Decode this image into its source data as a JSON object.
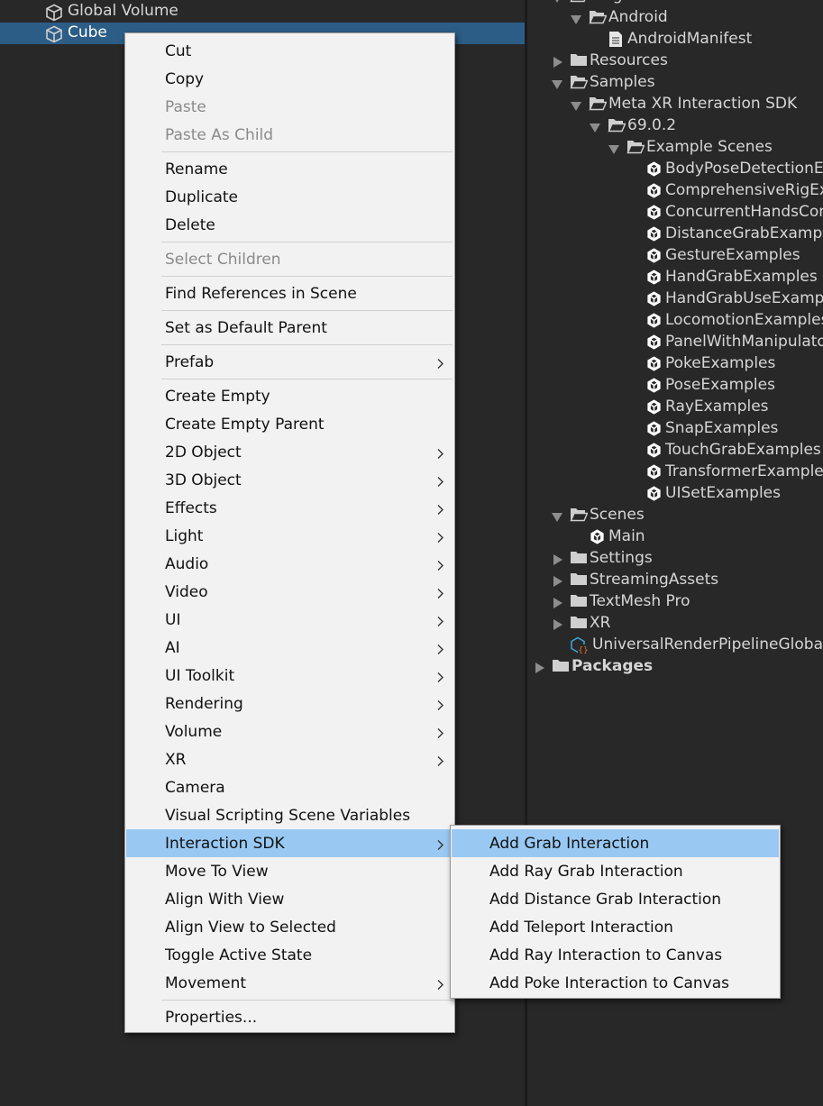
{
  "hierarchy": {
    "items": [
      {
        "label": "Global Volume",
        "selected": false
      },
      {
        "label": "Cube",
        "selected": true
      }
    ]
  },
  "project": {
    "items": [
      {
        "label": "Plugins",
        "arrow": "down",
        "icon": "folder-open",
        "indent": 0
      },
      {
        "label": "Android",
        "arrow": "down",
        "icon": "folder-open",
        "indent": 1
      },
      {
        "label": "AndroidManifest",
        "arrow": "none",
        "icon": "document",
        "indent": 2
      },
      {
        "label": "Resources",
        "arrow": "right",
        "icon": "folder",
        "indent": 0
      },
      {
        "label": "Samples",
        "arrow": "down",
        "icon": "folder-open",
        "indent": 0
      },
      {
        "label": "Meta XR Interaction SDK",
        "arrow": "down",
        "icon": "folder-open",
        "indent": 1
      },
      {
        "label": "69.0.2",
        "arrow": "down",
        "icon": "folder-open",
        "indent": 2
      },
      {
        "label": "Example Scenes",
        "arrow": "down",
        "icon": "folder-open",
        "indent": 3
      },
      {
        "label": "BodyPoseDetectionExamples",
        "arrow": "none",
        "icon": "unity-scene",
        "indent": 4
      },
      {
        "label": "ComprehensiveRigExample",
        "arrow": "none",
        "icon": "unity-scene",
        "indent": 4
      },
      {
        "label": "ConcurrentHandsControllersExamples",
        "arrow": "none",
        "icon": "unity-scene",
        "indent": 4
      },
      {
        "label": "DistanceGrabExamples",
        "arrow": "none",
        "icon": "unity-scene",
        "indent": 4
      },
      {
        "label": "GestureExamples",
        "arrow": "none",
        "icon": "unity-scene",
        "indent": 4
      },
      {
        "label": "HandGrabExamples",
        "arrow": "none",
        "icon": "unity-scene",
        "indent": 4
      },
      {
        "label": "HandGrabUseExamples",
        "arrow": "none",
        "icon": "unity-scene",
        "indent": 4
      },
      {
        "label": "LocomotionExamples",
        "arrow": "none",
        "icon": "unity-scene",
        "indent": 4
      },
      {
        "label": "PanelWithManipulators",
        "arrow": "none",
        "icon": "unity-scene",
        "indent": 4
      },
      {
        "label": "PokeExamples",
        "arrow": "none",
        "icon": "unity-scene",
        "indent": 4
      },
      {
        "label": "PoseExamples",
        "arrow": "none",
        "icon": "unity-scene",
        "indent": 4
      },
      {
        "label": "RayExamples",
        "arrow": "none",
        "icon": "unity-scene",
        "indent": 4
      },
      {
        "label": "SnapExamples",
        "arrow": "none",
        "icon": "unity-scene",
        "indent": 4
      },
      {
        "label": "TouchGrabExamples",
        "arrow": "none",
        "icon": "unity-scene",
        "indent": 4
      },
      {
        "label": "TransformerExamples",
        "arrow": "none",
        "icon": "unity-scene",
        "indent": 4
      },
      {
        "label": "UISetExamples",
        "arrow": "none",
        "icon": "unity-scene",
        "indent": 4
      },
      {
        "label": "Scenes",
        "arrow": "down",
        "icon": "folder-open",
        "indent": 0
      },
      {
        "label": "Main",
        "arrow": "none",
        "icon": "unity-scene",
        "indent": 1
      },
      {
        "label": "Settings",
        "arrow": "right",
        "icon": "folder",
        "indent": 0
      },
      {
        "label": "StreamingAssets",
        "arrow": "right",
        "icon": "folder",
        "indent": 0
      },
      {
        "label": "TextMesh Pro",
        "arrow": "right",
        "icon": "folder",
        "indent": 0
      },
      {
        "label": "XR",
        "arrow": "right",
        "icon": "folder",
        "indent": 0
      },
      {
        "label": "UniversalRenderPipelineGlobalSettings",
        "arrow": "none",
        "icon": "settings-asset",
        "indent": 0
      },
      {
        "label": "Packages",
        "arrow": "right",
        "icon": "folder",
        "indent": -1,
        "bold": true
      }
    ]
  },
  "context_menu": {
    "items": [
      {
        "label": "Cut",
        "disabled": false,
        "submenu": false
      },
      {
        "label": "Copy",
        "disabled": false,
        "submenu": false
      },
      {
        "label": "Paste",
        "disabled": true,
        "submenu": false
      },
      {
        "label": "Paste As Child",
        "disabled": true,
        "submenu": false
      },
      {
        "sep": true
      },
      {
        "label": "Rename",
        "disabled": false,
        "submenu": false
      },
      {
        "label": "Duplicate",
        "disabled": false,
        "submenu": false
      },
      {
        "label": "Delete",
        "disabled": false,
        "submenu": false
      },
      {
        "sep": true
      },
      {
        "label": "Select Children",
        "disabled": true,
        "submenu": false
      },
      {
        "sep": true
      },
      {
        "label": "Find References in Scene",
        "disabled": false,
        "submenu": false
      },
      {
        "sep": true
      },
      {
        "label": "Set as Default Parent",
        "disabled": false,
        "submenu": false
      },
      {
        "sep": true
      },
      {
        "label": "Prefab",
        "disabled": false,
        "submenu": true
      },
      {
        "sep": true
      },
      {
        "label": "Create Empty",
        "disabled": false,
        "submenu": false
      },
      {
        "label": "Create Empty Parent",
        "disabled": false,
        "submenu": false
      },
      {
        "label": "2D Object",
        "disabled": false,
        "submenu": true
      },
      {
        "label": "3D Object",
        "disabled": false,
        "submenu": true
      },
      {
        "label": "Effects",
        "disabled": false,
        "submenu": true
      },
      {
        "label": "Light",
        "disabled": false,
        "submenu": true
      },
      {
        "label": "Audio",
        "disabled": false,
        "submenu": true
      },
      {
        "label": "Video",
        "disabled": false,
        "submenu": true
      },
      {
        "label": "UI",
        "disabled": false,
        "submenu": true
      },
      {
        "label": "AI",
        "disabled": false,
        "submenu": true
      },
      {
        "label": "UI Toolkit",
        "disabled": false,
        "submenu": true
      },
      {
        "label": "Rendering",
        "disabled": false,
        "submenu": true
      },
      {
        "label": "Volume",
        "disabled": false,
        "submenu": true
      },
      {
        "label": "XR",
        "disabled": false,
        "submenu": true
      },
      {
        "label": "Camera",
        "disabled": false,
        "submenu": false
      },
      {
        "label": "Visual Scripting Scene Variables",
        "disabled": false,
        "submenu": false
      },
      {
        "label": "Interaction SDK",
        "disabled": false,
        "submenu": true,
        "highlighted": true
      },
      {
        "label": "Move To View",
        "disabled": false,
        "submenu": false
      },
      {
        "label": "Align With View",
        "disabled": false,
        "submenu": false
      },
      {
        "label": "Align View to Selected",
        "disabled": false,
        "submenu": false
      },
      {
        "label": "Toggle Active State",
        "disabled": false,
        "submenu": false
      },
      {
        "label": "Movement",
        "disabled": false,
        "submenu": true
      },
      {
        "sep": true
      },
      {
        "label": "Properties...",
        "disabled": false,
        "submenu": false
      }
    ]
  },
  "submenu": {
    "items": [
      {
        "label": "Add Grab Interaction",
        "highlighted": true
      },
      {
        "label": "Add Ray Grab Interaction"
      },
      {
        "label": "Add Distance Grab Interaction"
      },
      {
        "label": "Add Teleport Interaction"
      },
      {
        "label": "Add Ray Interaction to Canvas"
      },
      {
        "label": "Add Poke Interaction to Canvas"
      }
    ]
  },
  "colors": {
    "panel_bg": "#282828",
    "selection_bg": "#2c5d87",
    "menu_bg": "#f2f2f2",
    "menu_highlight": "#99c9f3",
    "disabled_text": "#8a8a8a",
    "asset_icon_orange": "#e8712a",
    "asset_icon_blue": "#3fa7e0"
  }
}
